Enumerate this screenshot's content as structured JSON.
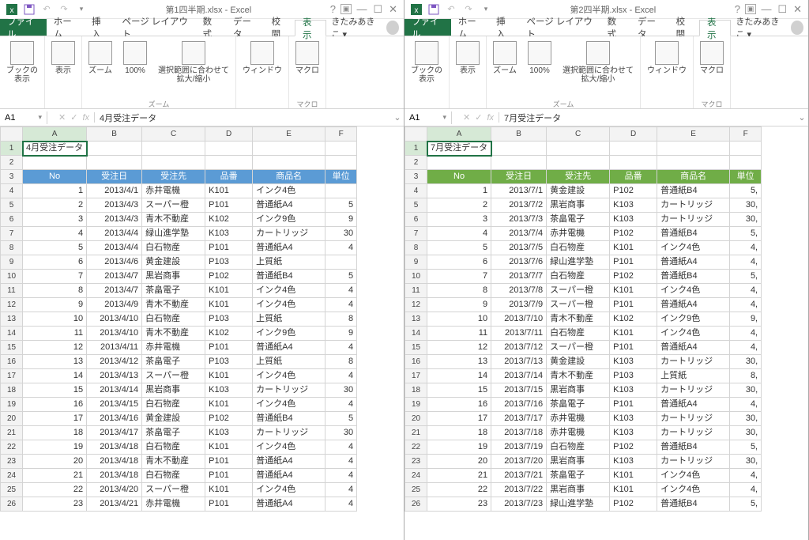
{
  "windows": [
    {
      "file": "第1四半期.xlsx - Excel",
      "cell": "A1",
      "formula": "4月受注データ",
      "tabs": {
        "file": "ファイル",
        "home": "ホーム",
        "insert": "挿入",
        "layout": "ページ レイアウト",
        "formulas": "数式",
        "data": "データ",
        "review": "校閲",
        "view": "表示"
      },
      "user": "きたみあきこ",
      "ribbon": {
        "book": "ブックの\n表示",
        "show": "表示",
        "zoom": "ズーム",
        "p100": "100%",
        "fit": "選択範囲に合わせて\n拡大/縮小",
        "window": "ウィンドウ",
        "macro": "マクロ"
      },
      "groups": {
        "g1": "",
        "g2": "ズーム",
        "g3": "",
        "g4": "マクロ"
      },
      "title": "4月受注データ",
      "hdr": [
        "No",
        "受注日",
        "受注先",
        "品番",
        "商品名",
        "単位"
      ],
      "rows": [
        [
          "1",
          "2013/4/1",
          "赤井電機",
          "K101",
          "インク4色",
          " "
        ],
        [
          "2",
          "2013/4/3",
          "スーパー橙",
          "P101",
          "普通紙A4",
          "5"
        ],
        [
          "3",
          "2013/4/3",
          "青木不動産",
          "K102",
          "インク9色",
          "9"
        ],
        [
          "4",
          "2013/4/4",
          "緑山進学塾",
          "K103",
          "カートリッジ",
          "30"
        ],
        [
          "5",
          "2013/4/4",
          "白石物産",
          "P101",
          "普通紙A4",
          "4"
        ],
        [
          "6",
          "2013/4/6",
          "黄金建設",
          "P103",
          "上質紙",
          " "
        ],
        [
          "7",
          "2013/4/7",
          "黒岩商事",
          "P102",
          "普通紙B4",
          "5"
        ],
        [
          "8",
          "2013/4/7",
          "茶畠電子",
          "K101",
          "インク4色",
          "4"
        ],
        [
          "9",
          "2013/4/9",
          "青木不動産",
          "K101",
          "インク4色",
          "4"
        ],
        [
          "10",
          "2013/4/10",
          "白石物産",
          "P103",
          "上質紙",
          "8"
        ],
        [
          "11",
          "2013/4/10",
          "青木不動産",
          "K102",
          "インク9色",
          "9"
        ],
        [
          "12",
          "2013/4/11",
          "赤井電機",
          "P101",
          "普通紙A4",
          "4"
        ],
        [
          "13",
          "2013/4/12",
          "茶畠電子",
          "P103",
          "上質紙",
          "8"
        ],
        [
          "14",
          "2013/4/13",
          "スーパー橙",
          "K101",
          "インク4色",
          "4"
        ],
        [
          "15",
          "2013/4/14",
          "黒岩商事",
          "K103",
          "カートリッジ",
          "30"
        ],
        [
          "16",
          "2013/4/15",
          "白石物産",
          "K101",
          "インク4色",
          "4"
        ],
        [
          "17",
          "2013/4/16",
          "黄金建設",
          "P102",
          "普通紙B4",
          "5"
        ],
        [
          "18",
          "2013/4/17",
          "茶畠電子",
          "K103",
          "カートリッジ",
          "30"
        ],
        [
          "19",
          "2013/4/18",
          "白石物産",
          "K101",
          "インク4色",
          "4"
        ],
        [
          "20",
          "2013/4/18",
          "青木不動産",
          "P101",
          "普通紙A4",
          "4"
        ],
        [
          "21",
          "2013/4/18",
          "白石物産",
          "P101",
          "普通紙A4",
          "4"
        ],
        [
          "22",
          "2013/4/20",
          "スーパー橙",
          "K101",
          "インク4色",
          "4"
        ],
        [
          "23",
          "2013/4/21",
          "赤井電機",
          "P101",
          "普通紙A4",
          "4"
        ]
      ],
      "hstyle": "hrow-blue"
    },
    {
      "file": "第2四半期.xlsx - Excel",
      "cell": "A1",
      "formula": "7月受注データ",
      "tabs": {
        "file": "ファイル",
        "home": "ホーム",
        "insert": "挿入",
        "layout": "ページ レイアウト",
        "formulas": "数式",
        "data": "データ",
        "review": "校閲",
        "view": "表示"
      },
      "user": "きたみあきこ",
      "ribbon": {
        "book": "ブックの\n表示",
        "show": "表示",
        "zoom": "ズーム",
        "p100": "100%",
        "fit": "選択範囲に合わせて\n拡大/縮小",
        "window": "ウィンドウ",
        "macro": "マクロ"
      },
      "groups": {
        "g1": "",
        "g2": "ズーム",
        "g3": "",
        "g4": "マクロ"
      },
      "title": "7月受注データ",
      "hdr": [
        "No",
        "受注日",
        "受注先",
        "品番",
        "商品名",
        "単位"
      ],
      "rows": [
        [
          "1",
          "2013/7/1",
          "黄金建設",
          "P102",
          "普通紙B4",
          "5,"
        ],
        [
          "2",
          "2013/7/2",
          "黒岩商事",
          "K103",
          "カートリッジ",
          "30,"
        ],
        [
          "3",
          "2013/7/3",
          "茶畠電子",
          "K103",
          "カートリッジ",
          "30,"
        ],
        [
          "4",
          "2013/7/4",
          "赤井電機",
          "P102",
          "普通紙B4",
          "5,"
        ],
        [
          "5",
          "2013/7/5",
          "白石物産",
          "K101",
          "インク4色",
          "4,"
        ],
        [
          "6",
          "2013/7/6",
          "緑山進学塾",
          "P101",
          "普通紙A4",
          "4,"
        ],
        [
          "7",
          "2013/7/7",
          "白石物産",
          "P102",
          "普通紙B4",
          "5,"
        ],
        [
          "8",
          "2013/7/8",
          "スーパー橙",
          "K101",
          "インク4色",
          "4,"
        ],
        [
          "9",
          "2013/7/9",
          "スーパー橙",
          "P101",
          "普通紙A4",
          "4,"
        ],
        [
          "10",
          "2013/7/10",
          "青木不動産",
          "K102",
          "インク9色",
          "9,"
        ],
        [
          "11",
          "2013/7/11",
          "白石物産",
          "K101",
          "インク4色",
          "4,"
        ],
        [
          "12",
          "2013/7/12",
          "スーパー橙",
          "P101",
          "普通紙A4",
          "4,"
        ],
        [
          "13",
          "2013/7/13",
          "黄金建設",
          "K103",
          "カートリッジ",
          "30,"
        ],
        [
          "14",
          "2013/7/14",
          "青木不動産",
          "P103",
          "上質紙",
          "8,"
        ],
        [
          "15",
          "2013/7/15",
          "黒岩商事",
          "K103",
          "カートリッジ",
          "30,"
        ],
        [
          "16",
          "2013/7/16",
          "茶畠電子",
          "P101",
          "普通紙A4",
          "4,"
        ],
        [
          "17",
          "2013/7/17",
          "赤井電機",
          "K103",
          "カートリッジ",
          "30,"
        ],
        [
          "18",
          "2013/7/18",
          "赤井電機",
          "K103",
          "カートリッジ",
          "30,"
        ],
        [
          "19",
          "2013/7/19",
          "白石物産",
          "P102",
          "普通紙B4",
          "5,"
        ],
        [
          "20",
          "2013/7/20",
          "黒岩商事",
          "K103",
          "カートリッジ",
          "30,"
        ],
        [
          "21",
          "2013/7/21",
          "茶畠電子",
          "K101",
          "インク4色",
          "4,"
        ],
        [
          "22",
          "2013/7/22",
          "黒岩商事",
          "K101",
          "インク4色",
          "4,"
        ],
        [
          "23",
          "2013/7/23",
          "緑山進学塾",
          "P102",
          "普通紙B4",
          "5,"
        ]
      ],
      "hstyle": "hrow-green"
    }
  ],
  "cols": [
    "A",
    "B",
    "C",
    "D",
    "E",
    "F"
  ]
}
